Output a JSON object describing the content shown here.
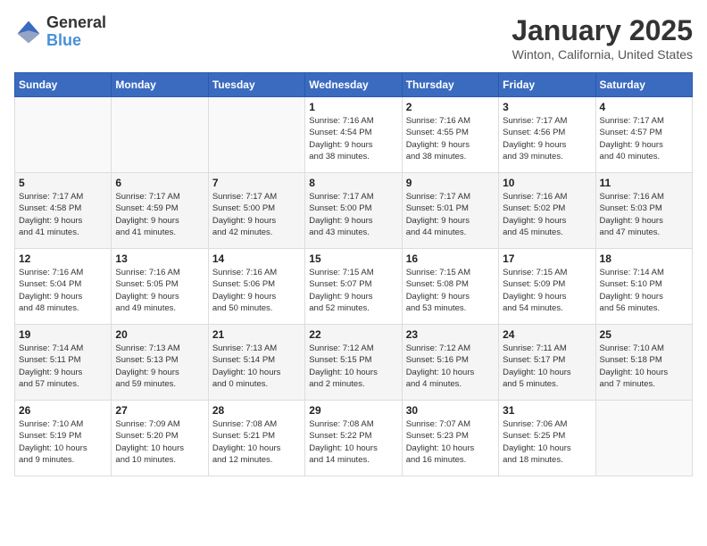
{
  "header": {
    "logo": {
      "line1": "General",
      "line2": "Blue"
    },
    "title": "January 2025",
    "subtitle": "Winton, California, United States"
  },
  "weekdays": [
    "Sunday",
    "Monday",
    "Tuesday",
    "Wednesday",
    "Thursday",
    "Friday",
    "Saturday"
  ],
  "weeks": [
    [
      {
        "day": "",
        "content": ""
      },
      {
        "day": "",
        "content": ""
      },
      {
        "day": "",
        "content": ""
      },
      {
        "day": "1",
        "content": "Sunrise: 7:16 AM\nSunset: 4:54 PM\nDaylight: 9 hours\nand 38 minutes."
      },
      {
        "day": "2",
        "content": "Sunrise: 7:16 AM\nSunset: 4:55 PM\nDaylight: 9 hours\nand 38 minutes."
      },
      {
        "day": "3",
        "content": "Sunrise: 7:17 AM\nSunset: 4:56 PM\nDaylight: 9 hours\nand 39 minutes."
      },
      {
        "day": "4",
        "content": "Sunrise: 7:17 AM\nSunset: 4:57 PM\nDaylight: 9 hours\nand 40 minutes."
      }
    ],
    [
      {
        "day": "5",
        "content": "Sunrise: 7:17 AM\nSunset: 4:58 PM\nDaylight: 9 hours\nand 41 minutes."
      },
      {
        "day": "6",
        "content": "Sunrise: 7:17 AM\nSunset: 4:59 PM\nDaylight: 9 hours\nand 41 minutes."
      },
      {
        "day": "7",
        "content": "Sunrise: 7:17 AM\nSunset: 5:00 PM\nDaylight: 9 hours\nand 42 minutes."
      },
      {
        "day": "8",
        "content": "Sunrise: 7:17 AM\nSunset: 5:00 PM\nDaylight: 9 hours\nand 43 minutes."
      },
      {
        "day": "9",
        "content": "Sunrise: 7:17 AM\nSunset: 5:01 PM\nDaylight: 9 hours\nand 44 minutes."
      },
      {
        "day": "10",
        "content": "Sunrise: 7:16 AM\nSunset: 5:02 PM\nDaylight: 9 hours\nand 45 minutes."
      },
      {
        "day": "11",
        "content": "Sunrise: 7:16 AM\nSunset: 5:03 PM\nDaylight: 9 hours\nand 47 minutes."
      }
    ],
    [
      {
        "day": "12",
        "content": "Sunrise: 7:16 AM\nSunset: 5:04 PM\nDaylight: 9 hours\nand 48 minutes."
      },
      {
        "day": "13",
        "content": "Sunrise: 7:16 AM\nSunset: 5:05 PM\nDaylight: 9 hours\nand 49 minutes."
      },
      {
        "day": "14",
        "content": "Sunrise: 7:16 AM\nSunset: 5:06 PM\nDaylight: 9 hours\nand 50 minutes."
      },
      {
        "day": "15",
        "content": "Sunrise: 7:15 AM\nSunset: 5:07 PM\nDaylight: 9 hours\nand 52 minutes."
      },
      {
        "day": "16",
        "content": "Sunrise: 7:15 AM\nSunset: 5:08 PM\nDaylight: 9 hours\nand 53 minutes."
      },
      {
        "day": "17",
        "content": "Sunrise: 7:15 AM\nSunset: 5:09 PM\nDaylight: 9 hours\nand 54 minutes."
      },
      {
        "day": "18",
        "content": "Sunrise: 7:14 AM\nSunset: 5:10 PM\nDaylight: 9 hours\nand 56 minutes."
      }
    ],
    [
      {
        "day": "19",
        "content": "Sunrise: 7:14 AM\nSunset: 5:11 PM\nDaylight: 9 hours\nand 57 minutes."
      },
      {
        "day": "20",
        "content": "Sunrise: 7:13 AM\nSunset: 5:13 PM\nDaylight: 9 hours\nand 59 minutes."
      },
      {
        "day": "21",
        "content": "Sunrise: 7:13 AM\nSunset: 5:14 PM\nDaylight: 10 hours\nand 0 minutes."
      },
      {
        "day": "22",
        "content": "Sunrise: 7:12 AM\nSunset: 5:15 PM\nDaylight: 10 hours\nand 2 minutes."
      },
      {
        "day": "23",
        "content": "Sunrise: 7:12 AM\nSunset: 5:16 PM\nDaylight: 10 hours\nand 4 minutes."
      },
      {
        "day": "24",
        "content": "Sunrise: 7:11 AM\nSunset: 5:17 PM\nDaylight: 10 hours\nand 5 minutes."
      },
      {
        "day": "25",
        "content": "Sunrise: 7:10 AM\nSunset: 5:18 PM\nDaylight: 10 hours\nand 7 minutes."
      }
    ],
    [
      {
        "day": "26",
        "content": "Sunrise: 7:10 AM\nSunset: 5:19 PM\nDaylight: 10 hours\nand 9 minutes."
      },
      {
        "day": "27",
        "content": "Sunrise: 7:09 AM\nSunset: 5:20 PM\nDaylight: 10 hours\nand 10 minutes."
      },
      {
        "day": "28",
        "content": "Sunrise: 7:08 AM\nSunset: 5:21 PM\nDaylight: 10 hours\nand 12 minutes."
      },
      {
        "day": "29",
        "content": "Sunrise: 7:08 AM\nSunset: 5:22 PM\nDaylight: 10 hours\nand 14 minutes."
      },
      {
        "day": "30",
        "content": "Sunrise: 7:07 AM\nSunset: 5:23 PM\nDaylight: 10 hours\nand 16 minutes."
      },
      {
        "day": "31",
        "content": "Sunrise: 7:06 AM\nSunset: 5:25 PM\nDaylight: 10 hours\nand 18 minutes."
      },
      {
        "day": "",
        "content": ""
      }
    ]
  ]
}
